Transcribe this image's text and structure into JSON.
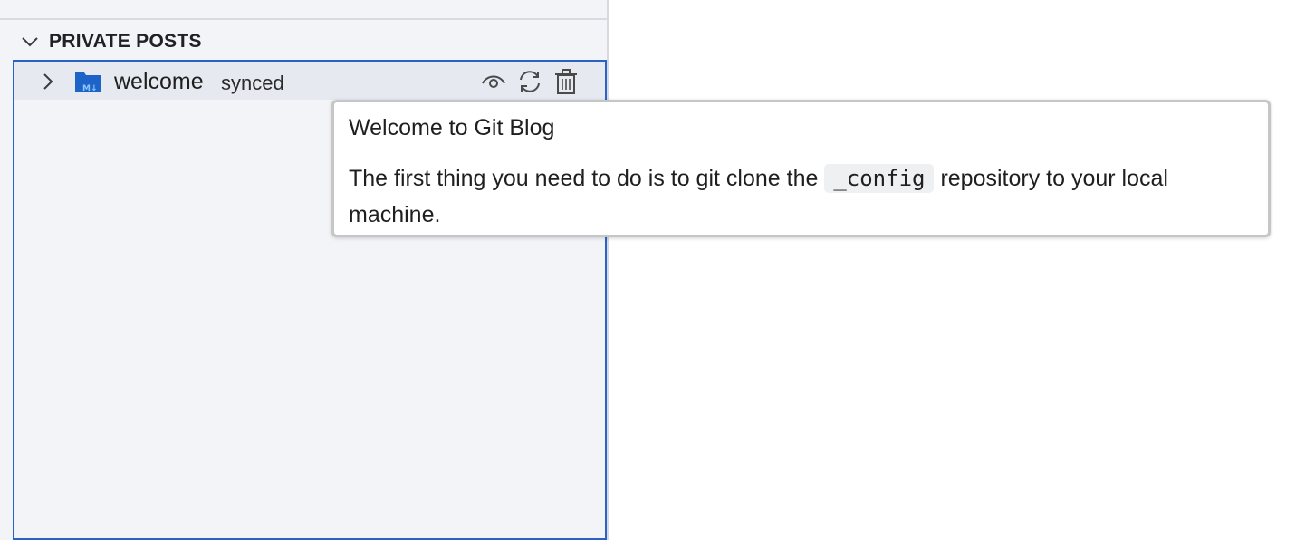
{
  "section": {
    "title": "PRIVATE POSTS"
  },
  "tree": {
    "items": [
      {
        "label": "welcome",
        "status": "synced",
        "icon": "markdown-folder-icon"
      }
    ],
    "actions": [
      "eye-icon",
      "sync-icon",
      "trash-icon"
    ]
  },
  "tooltip": {
    "title": "Welcome to Git Blog",
    "body_before": "The first thing you need to do is to git clone the",
    "code": "_config",
    "body_after": "repository to your local machine."
  },
  "colors": {
    "sidebar_bg": "#f3f4f8",
    "focus_border": "#2a63c8",
    "folder_blue": "#1e64c8",
    "row_selected": "#e6e9f0"
  }
}
